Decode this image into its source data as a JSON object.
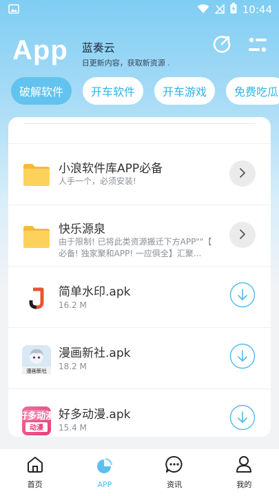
{
  "status_bar": {
    "time": "10:44"
  },
  "header": {
    "title": "App",
    "name": "蓝奏云",
    "subtitle": "日更新内容，获取新资源 ."
  },
  "tabs": [
    {
      "label": "破解软件",
      "active": true
    },
    {
      "label": "开车软件",
      "active": false
    },
    {
      "label": "开车游戏",
      "active": false
    },
    {
      "label": "免费吃瓜",
      "active": false
    }
  ],
  "list": [
    {
      "type": "folder",
      "title": "小浪软件库APP必备",
      "subtitle_lines": [
        "人手一个，必须安装!"
      ]
    },
    {
      "type": "folder",
      "title": "快乐源泉",
      "subtitle_lines": [
        "由于限制!  已将此类资源搬迁下方APP\"\"【",
        "必备!  独家聚和APP!  一应俱全】汇聚..."
      ]
    },
    {
      "type": "file",
      "title": "简单水印.apk",
      "size": "16.2 M",
      "icon": "j-watermark-icon"
    },
    {
      "type": "file",
      "title": "漫画新社.apk",
      "size": "18.2 M",
      "icon": "manga-app-icon",
      "icon_text": "漫画新社"
    },
    {
      "type": "file",
      "title": "好多动漫.apk",
      "size": "15.4 M",
      "icon": "anime-app-icon",
      "icon_text": "好多动漫"
    }
  ],
  "bottom_nav": [
    {
      "label": "首页",
      "icon": "home-icon",
      "active": false
    },
    {
      "label": "APP",
      "icon": "pie-chart-icon",
      "active": true
    },
    {
      "label": "资讯",
      "icon": "chat-bubble-icon",
      "active": false
    },
    {
      "label": "我的",
      "icon": "user-icon",
      "active": false
    }
  ],
  "colors": {
    "accent": "#4fb9ea",
    "tab_active_bg": "#62c3ee",
    "folder": "#fcc94a"
  }
}
